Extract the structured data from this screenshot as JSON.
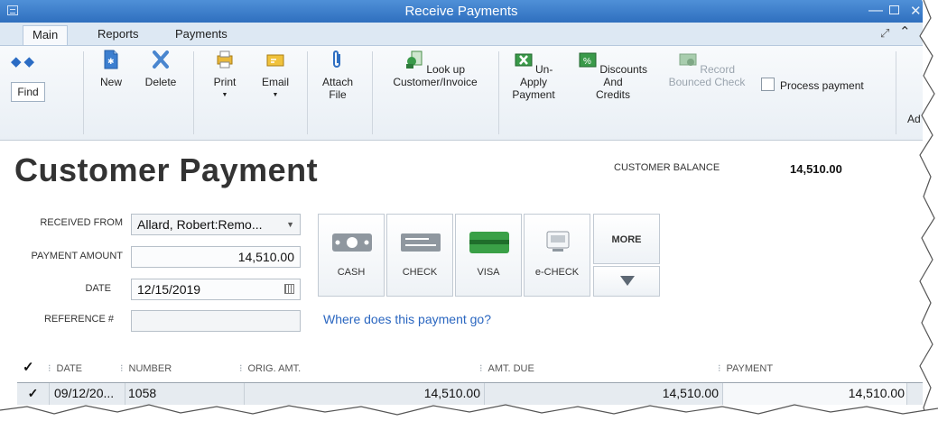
{
  "window": {
    "title": "Receive Payments"
  },
  "tabs": [
    {
      "label": "Main"
    },
    {
      "label": "Reports"
    },
    {
      "label": "Payments"
    }
  ],
  "ribbon": {
    "find": "Find",
    "new": "New",
    "delete": "Delete",
    "print": "Print",
    "email": "Email",
    "attach_line1": "Attach",
    "attach_line2": "File",
    "lookup_line1": "Look up",
    "lookup_line2": "Customer/Invoice",
    "unapply_line1": "Un-Apply",
    "unapply_line2": "Payment",
    "discounts_line1": "Discounts And",
    "discounts_line2": "Credits",
    "record_line1": "Record",
    "record_line2": "Bounced Check",
    "process_payment": "Process payment",
    "add_partial": "Ad"
  },
  "form": {
    "heading": "Customer Payment",
    "balance_label": "CUSTOMER BALANCE",
    "balance_value": "14,510.00",
    "received_from_label": "RECEIVED FROM",
    "received_from_value": "Allard, Robert:Remo...",
    "payment_amount_label": "PAYMENT AMOUNT",
    "payment_amount_value": "14,510.00",
    "date_label": "DATE",
    "date_value": "12/15/2019",
    "reference_label": "REFERENCE #",
    "reference_value": "",
    "link": "Where does this payment go?"
  },
  "payment_methods": [
    {
      "label": "CASH",
      "icon": "cash-icon"
    },
    {
      "label": "CHECK",
      "icon": "check-icon"
    },
    {
      "label": "VISA",
      "icon": "visa-card-icon"
    },
    {
      "label": "e-CHECK",
      "icon": "echeck-icon"
    }
  ],
  "more_label": "MORE",
  "table": {
    "check_header": "✓",
    "columns": [
      "DATE",
      "NUMBER",
      "ORIG. AMT.",
      "AMT. DUE",
      "PAYMENT"
    ],
    "rows": [
      {
        "check": "✓",
        "date": "09/12/20...",
        "number": "1058",
        "orig_amt": "14,510.00",
        "amt_due": "14,510.00",
        "payment": "14,510.00"
      }
    ]
  },
  "colors": {
    "titlebar": "#3a7bc8",
    "link": "#2a66c0",
    "ribbon_icon_blue": "#2b6cc4",
    "ribbon_icon_green": "#3a9a4a"
  }
}
